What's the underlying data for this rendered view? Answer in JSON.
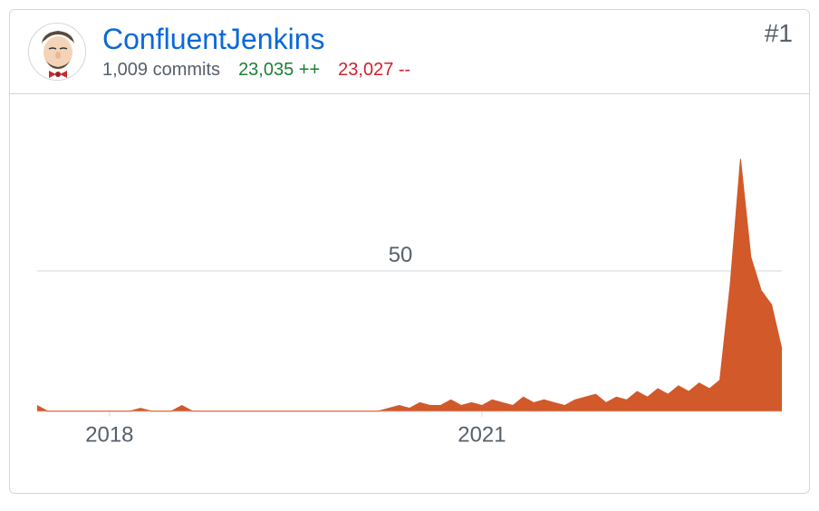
{
  "header": {
    "username": "ConfluentJenkins",
    "commits": "1,009 commits",
    "additions": "23,035 ++",
    "deletions": "23,027 --",
    "rank": "#1"
  },
  "chart_data": {
    "type": "area",
    "title": "",
    "xlabel": "",
    "ylabel": "",
    "ylim": [
      0,
      100
    ],
    "yticks": [
      50
    ],
    "xticks": [
      "2018",
      "2021"
    ],
    "x_domain": [
      "2017-06",
      "2023-06"
    ],
    "series": [
      {
        "name": "commits",
        "x": [
          "2017-06",
          "2017-07",
          "2017-08",
          "2017-09",
          "2017-10",
          "2017-11",
          "2017-12",
          "2018-01",
          "2018-02",
          "2018-03",
          "2018-04",
          "2018-05",
          "2018-06",
          "2018-07",
          "2018-08",
          "2018-09",
          "2018-10",
          "2018-11",
          "2018-12",
          "2019-01",
          "2019-02",
          "2019-03",
          "2019-04",
          "2019-05",
          "2019-06",
          "2019-07",
          "2019-08",
          "2019-09",
          "2019-10",
          "2019-11",
          "2019-12",
          "2020-01",
          "2020-02",
          "2020-03",
          "2020-04",
          "2020-05",
          "2020-06",
          "2020-07",
          "2020-08",
          "2020-09",
          "2020-10",
          "2020-11",
          "2020-12",
          "2021-01",
          "2021-02",
          "2021-03",
          "2021-04",
          "2021-05",
          "2021-06",
          "2021-07",
          "2021-08",
          "2021-09",
          "2021-10",
          "2021-11",
          "2021-12",
          "2022-01",
          "2022-02",
          "2022-03",
          "2022-04",
          "2022-05",
          "2022-06",
          "2022-07",
          "2022-08",
          "2022-09",
          "2022-10",
          "2022-11",
          "2022-12",
          "2023-01",
          "2023-02",
          "2023-03",
          "2023-04",
          "2023-05",
          "2023-06"
        ],
        "values": [
          2,
          0,
          0,
          0,
          0,
          0,
          0,
          0,
          0,
          0,
          1,
          0,
          0,
          0,
          2,
          0,
          0,
          0,
          0,
          0,
          0,
          0,
          0,
          0,
          0,
          0,
          0,
          0,
          0,
          0,
          0,
          0,
          0,
          0,
          1,
          2,
          1,
          3,
          2,
          2,
          4,
          2,
          3,
          2,
          4,
          3,
          2,
          5,
          3,
          4,
          3,
          2,
          4,
          5,
          6,
          3,
          5,
          4,
          7,
          5,
          8,
          6,
          9,
          7,
          10,
          8,
          11,
          45,
          90,
          55,
          43,
          38,
          22
        ]
      }
    ]
  }
}
